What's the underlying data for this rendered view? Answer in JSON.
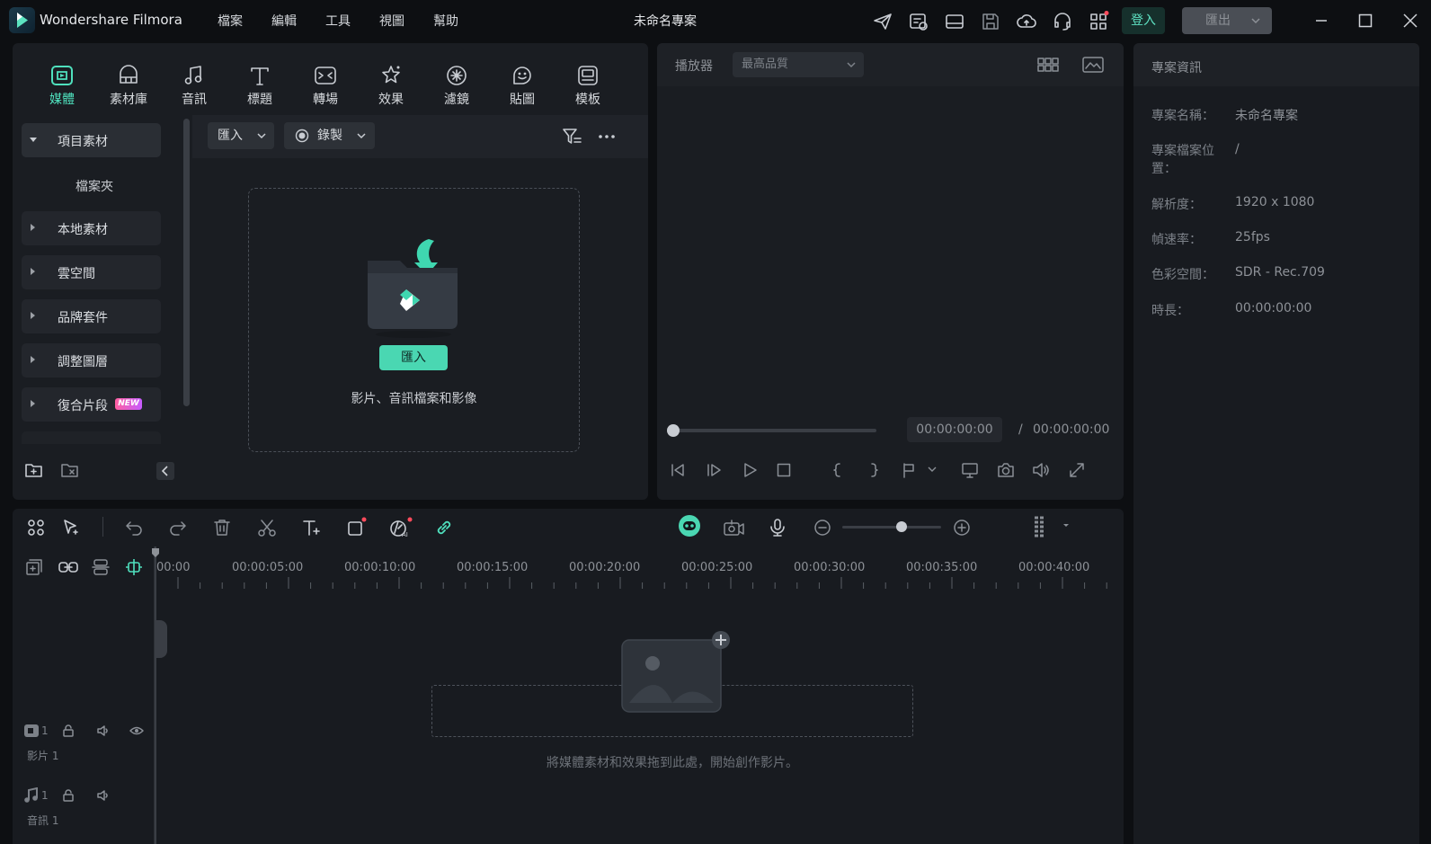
{
  "app": {
    "name": "Wondershare Filmora",
    "project_title": "未命名專案",
    "menu": [
      "檔案",
      "編輯",
      "工具",
      "視圖",
      "幫助"
    ],
    "login_label": "登入",
    "export_label": "匯出"
  },
  "colors": {
    "accent": "#4ad7b2",
    "accent_text": "#4fe0bd",
    "panel": "#1a1d22",
    "background": "#0d0f12"
  },
  "tabs": [
    {
      "label": "媒體",
      "icon": "media-icon",
      "active": true
    },
    {
      "label": "素材庫",
      "icon": "stock-library-icon"
    },
    {
      "label": "音訊",
      "icon": "music-note-icon"
    },
    {
      "label": "標題",
      "icon": "title-text-icon"
    },
    {
      "label": "轉場",
      "icon": "transition-icon"
    },
    {
      "label": "效果",
      "icon": "effects-star-icon"
    },
    {
      "label": "濾鏡",
      "icon": "filter-icon"
    },
    {
      "label": "貼圖",
      "icon": "sticker-icon"
    },
    {
      "label": "模板",
      "icon": "template-icon"
    }
  ],
  "sidebar": {
    "project_media": "項目素材",
    "folder": "檔案夾",
    "items": [
      "本地素材",
      "雲空間",
      "品牌套件",
      "調整圖層",
      "復合片段"
    ],
    "new_badge": "NEW"
  },
  "media": {
    "import_dropdown": "匯入",
    "record_dropdown": "錄製",
    "import_button": "匯入",
    "import_caption": "影片、音訊檔案和影像"
  },
  "player": {
    "label": "播放器",
    "quality": "最高品質",
    "time_current": "00:00:00:00",
    "time_separator": "/",
    "time_total": "00:00:00:00",
    "progress": 0
  },
  "info": {
    "header": "專案資訊",
    "rows": [
      {
        "label": "專案名稱：",
        "value": "未命名專案"
      },
      {
        "label": "專案檔案位置：",
        "value": "/"
      },
      {
        "label": "解析度：",
        "value": "1920 x 1080"
      },
      {
        "label": "幀速率：",
        "value": "25fps"
      },
      {
        "label": "色彩空間：",
        "value": "SDR - Rec.709"
      },
      {
        "label": "時長：",
        "value": "00:00:00:00"
      }
    ]
  },
  "timeline": {
    "ruler": [
      "00:00",
      "00:00:05:00",
      "00:00:10:00",
      "00:00:15:00",
      "00:00:20:00",
      "00:00:25:00",
      "00:00:30:00",
      "00:00:35:00",
      "00:00:40:00"
    ],
    "video_track": "影片 1",
    "audio_track": "音訊 1",
    "track_number": "1",
    "drop_caption": "將媒體素材和效果拖到此處，開始創作影片。",
    "zoom_level": 0.6
  }
}
